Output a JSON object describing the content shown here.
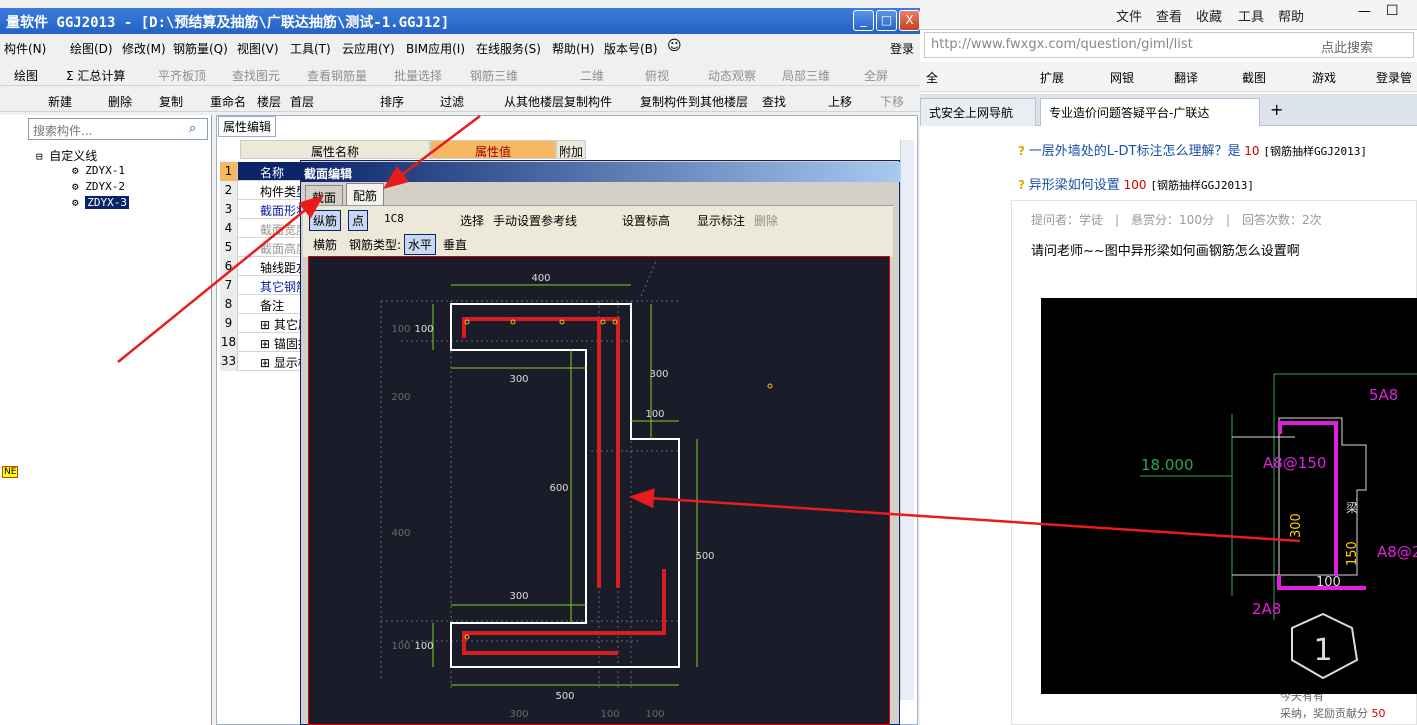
{
  "app": {
    "title": "量软件 GGJ2013 - [D:\\预结算及抽筋\\广联达抽筋\\测试-1.GGJ12]",
    "win_min": "_",
    "win_max": "□",
    "win_close": "X",
    "menu": [
      "构件(N)",
      "绘图(D)",
      "修改(M)",
      "钢筋量(Q)",
      "视图(V)",
      "工具(T)",
      "云应用(Y)",
      "BIM应用(I)",
      "在线服务(S)",
      "帮助(H)",
      "版本号(B)"
    ],
    "login": "登录",
    "toolbar1": [
      "绘图",
      "Σ 汇总计算",
      "平齐板顶",
      "查找图元",
      "查看钢筋量",
      "批量选择",
      "钢筋三维",
      "二维",
      "俯视",
      "动态观察",
      "局部三维",
      "全屏"
    ],
    "toolbar2": [
      "新建",
      "删除",
      "复制",
      "重命名",
      "楼层",
      "首层",
      "排序",
      "过滤",
      "从其他楼层复制构件",
      "复制构件到其他楼层",
      "查找",
      "上移",
      "下移"
    ],
    "search_placeholder": "搜索构件...",
    "tree_root": "自定义线",
    "tree_items": [
      "ZDYX-1",
      "ZDYX-2",
      "ZDYX-3"
    ],
    "prop_tab": "属性编辑",
    "prop_headers": [
      "属性名称",
      "属性值",
      "附加"
    ],
    "props": [
      {
        "n": "1",
        "t": "名称"
      },
      {
        "n": "2",
        "t": "构件类型"
      },
      {
        "n": "3",
        "t": "截面形状"
      },
      {
        "n": "4",
        "t": "截面宽度"
      },
      {
        "n": "5",
        "t": "截面高度"
      },
      {
        "n": "6",
        "t": "轴线距左"
      },
      {
        "n": "7",
        "t": "其它钢筋"
      },
      {
        "n": "8",
        "t": "备注"
      },
      {
        "n": "9",
        "t": "其它属性"
      },
      {
        "n": "18",
        "t": "锚固搭接"
      },
      {
        "n": "33",
        "t": "显示样式"
      }
    ],
    "left_edge_label": "NE"
  },
  "dialog": {
    "title": "截面编辑",
    "tabs": [
      "截面",
      "配筋"
    ],
    "tools": [
      "纵筋",
      "点",
      "1C8",
      "选择",
      "手动设置参考线",
      "设置标高",
      "显示标注",
      "删除"
    ],
    "row2": [
      "横筋",
      "钢筋类型:",
      "水平",
      "垂直"
    ],
    "dims": {
      "top": "400",
      "left_top": "100",
      "inner_top": "300",
      "right_top": "300",
      "step": "100",
      "mid": "600",
      "right": "500",
      "inner_bot": "300",
      "left_bot": "100",
      "bottom": "500",
      "faint_100a": "100",
      "faint_200": "200",
      "faint_400": "400",
      "faint_100b": "100",
      "b300": "300",
      "b100a": "100",
      "b100b": "100"
    }
  },
  "browser": {
    "menu": [
      "文件",
      "查看",
      "收藏",
      "工具",
      "帮助"
    ],
    "url": "http://www.fwxgx.com/question/giml/list",
    "search_ph": "点此搜索",
    "bar": [
      "扩展",
      "网银",
      "翻译",
      "截图",
      "游戏",
      "登录管"
    ],
    "bar_left": "全",
    "tab_prev": "式安全上网导航",
    "tab_active": "专业造价问题答疑平台-广联达",
    "q1": "一层外墙处的L-DT标注怎么理解？是",
    "q1_score": "10",
    "q1_tag": "[钢筋抽样GGJ2013]",
    "q2": "异形梁如何设置",
    "q2_score": "100",
    "q2_tag": "[钢筋抽样GGJ2013]",
    "meta": "提问者：学徒　|　悬赏分：100分　|　回答次数：2次",
    "body": "请问老师~~图中异形梁如何画钢筋怎么设置啊",
    "cad": {
      "a1": "5A8",
      "a2": "A8@150",
      "a3": "18.000",
      "a4": "300",
      "a5": "150",
      "a6": "A8@2",
      "a7": "100",
      "a8": "2A8",
      "a9": "1",
      "a10": "梁"
    },
    "footer1": "今天有有",
    "footer2": "采纳，奖励贡献分",
    "footer_num": "50"
  }
}
